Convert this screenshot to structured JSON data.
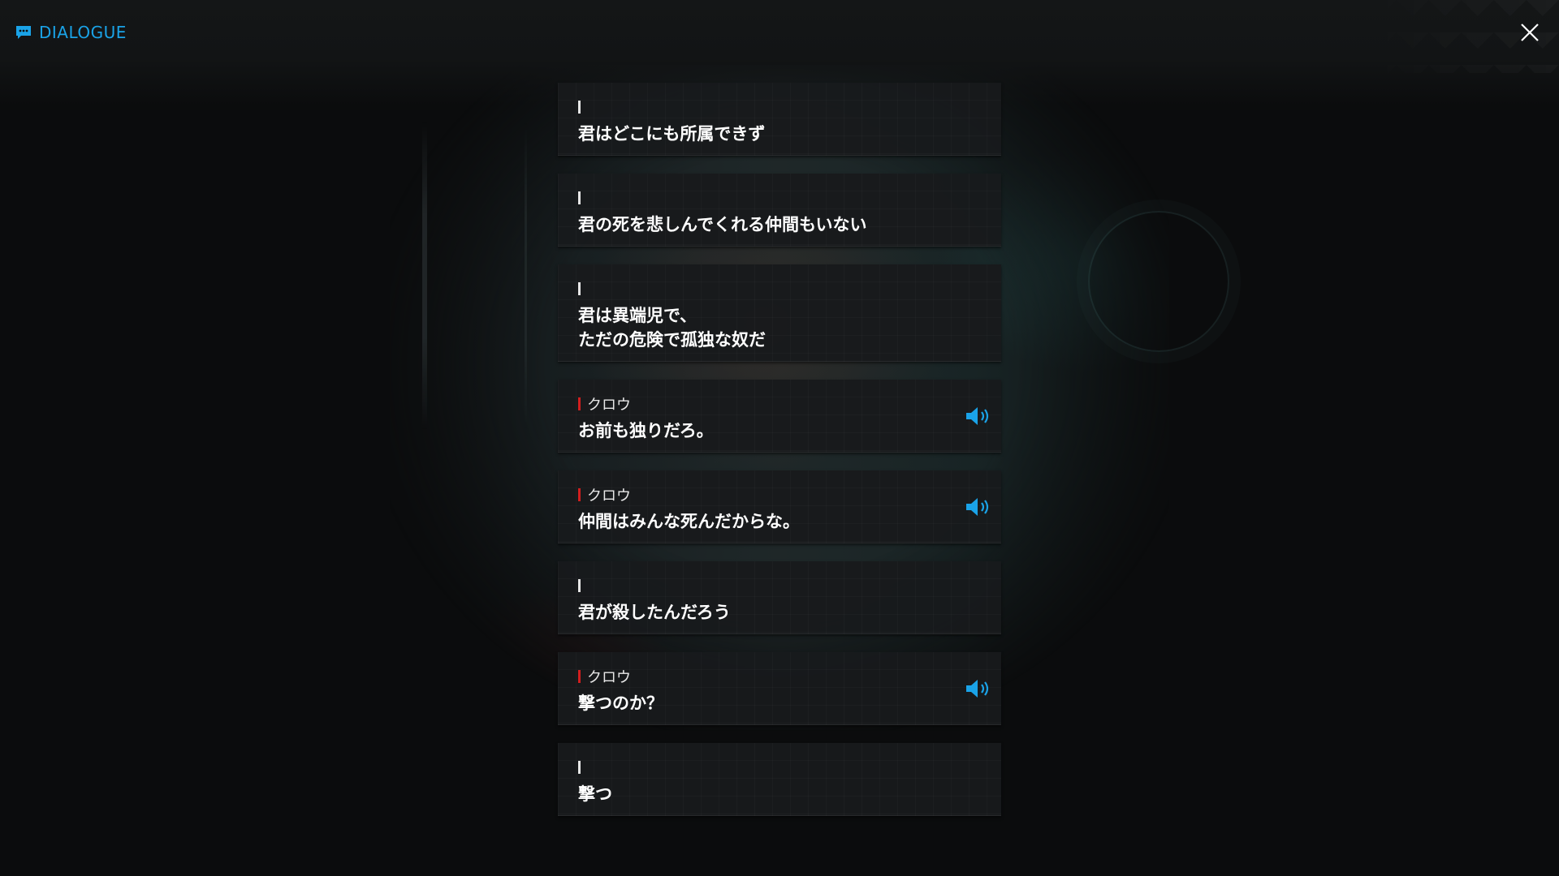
{
  "header": {
    "title": "DIALOGUE",
    "accent_color": "#1aa3e8",
    "icon": "chat-bubble-icon"
  },
  "close_icon": "close-icon",
  "dialogue": [
    {
      "speaker": "",
      "text": "君はどこにも所属できず",
      "voice": false
    },
    {
      "speaker": "",
      "text": "君の死を悲しんでくれる仲間もいない",
      "voice": false
    },
    {
      "speaker": "",
      "text": "君は異端児で、\nただの危険で孤独な奴だ",
      "voice": false
    },
    {
      "speaker": "クロウ",
      "text": "お前も独りだろ。",
      "voice": true
    },
    {
      "speaker": "クロウ",
      "text": "仲間はみんな死んだからな。",
      "voice": true
    },
    {
      "speaker": "",
      "text": "君が殺したんだろう",
      "voice": false
    },
    {
      "speaker": "クロウ",
      "text": "撃つのか？",
      "voice": true
    },
    {
      "speaker": "",
      "text": "撃つ",
      "voice": false
    }
  ],
  "colors": {
    "speaker_marker_named": "#d21e1e",
    "speaker_marker_player": "#e6e6e6",
    "voice_icon": "#1aa3e8"
  }
}
